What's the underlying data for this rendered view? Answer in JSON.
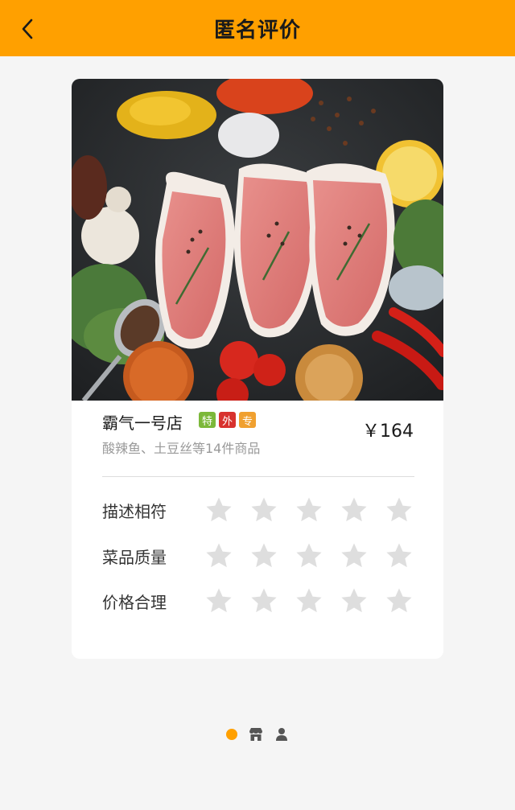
{
  "header": {
    "title": "匿名评价"
  },
  "shop": {
    "name": "霸气一号店",
    "badges": [
      {
        "label": "特",
        "color": "#7cb83a"
      },
      {
        "label": "外",
        "color": "#d8322e"
      },
      {
        "label": "专",
        "color": "#f0a030"
      }
    ],
    "price": "￥164",
    "description": "酸辣鱼、土豆丝等14件商品"
  },
  "ratings": [
    {
      "label": "描述相符",
      "stars": 0,
      "max": 5
    },
    {
      "label": "菜品质量",
      "stars": 0,
      "max": 5
    },
    {
      "label": "价格合理",
      "stars": 0,
      "max": 5
    }
  ],
  "colors": {
    "accent": "#ffa000",
    "star_empty": "#dedede"
  },
  "pager": {
    "active_index": 0,
    "icons": [
      "dot-active",
      "store-icon",
      "person-icon"
    ]
  }
}
